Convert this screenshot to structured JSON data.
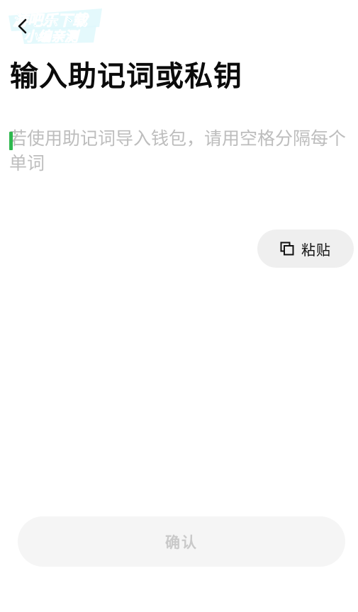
{
  "watermark": {
    "line1": "游吧乐下载",
    "line2": "小编亲测",
    "accent_color": "#1ec8e6"
  },
  "header": {
    "back_icon": "chevron-left-icon",
    "title": "输入助记词或私钥"
  },
  "input": {
    "placeholder": "若使用助记词导入钱包，请用空格分隔每个单词",
    "value": "",
    "caret_color": "#2fb84f"
  },
  "paste": {
    "icon": "copy-icon",
    "label": "粘贴"
  },
  "confirm": {
    "label": "确认",
    "enabled": false
  }
}
